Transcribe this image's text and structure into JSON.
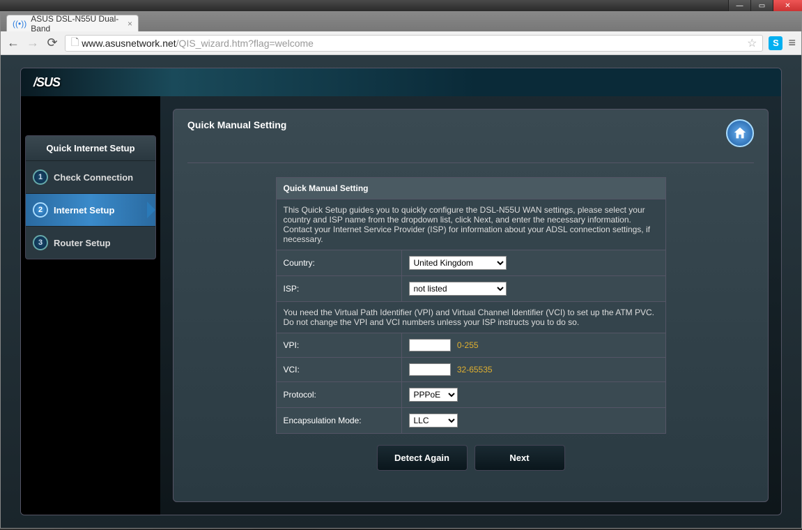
{
  "os": {
    "minimize": "—",
    "maximize": "▭",
    "close": "✕"
  },
  "browser": {
    "tab_title": "ASUS DSL-N55U Dual-Band",
    "url_domain": "www.asusnetwork.net",
    "url_path": "/QIS_wizard.htm?flag=welcome",
    "skype_glyph": "S"
  },
  "logo": "/SUS",
  "sidebar": {
    "title": "Quick Internet Setup",
    "steps": [
      {
        "num": "1",
        "label": "Check Connection"
      },
      {
        "num": "2",
        "label": "Internet Setup"
      },
      {
        "num": "3",
        "label": "Router Setup"
      }
    ]
  },
  "panel": {
    "title": "Quick Manual Setting",
    "table_header": "Quick Manual Setting",
    "intro": "This Quick Setup guides you to quickly configure the DSL-N55U WAN settings, please select your country and ISP name from the dropdown list, click Next, and enter the necessary information. Contact your Internet Service Provider (ISP) for information about your ADSL connection settings, if necessary.",
    "country_label": "Country:",
    "country_value": "United Kingdom",
    "isp_label": "ISP:",
    "isp_value": "not listed",
    "vpi_vci_note": "You need the Virtual Path Identifier (VPI) and Virtual Channel Identifier (VCI) to set up the ATM PVC. Do not change the VPI and VCI numbers unless your ISP instructs you to do so.",
    "vpi_label": "VPI:",
    "vpi_value": "",
    "vpi_hint": "0-255",
    "vci_label": "VCI:",
    "vci_value": "",
    "vci_hint": "32-65535",
    "protocol_label": "Protocol:",
    "protocol_value": "PPPoE",
    "encap_label": "Encapsulation Mode:",
    "encap_value": "LLC",
    "detect_btn": "Detect Again",
    "next_btn": "Next"
  }
}
